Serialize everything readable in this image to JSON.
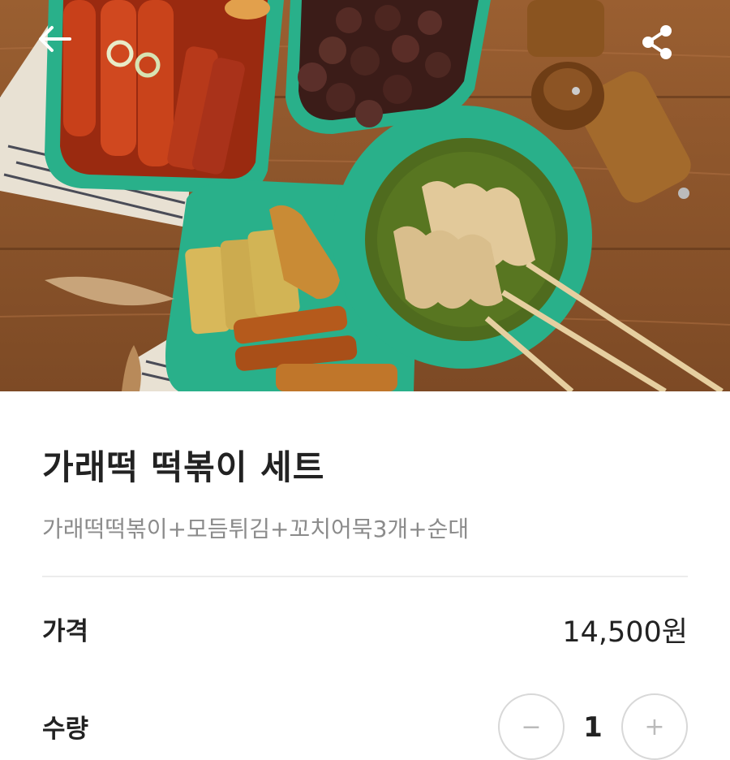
{
  "header": {
    "back_icon": "arrow-left-icon",
    "share_icon": "share-icon"
  },
  "product": {
    "title": "가래떡 떡볶이 세트",
    "description": "가래떡떡볶이+모듬튀김+꼬치어묵3개+순대"
  },
  "price": {
    "label": "가격",
    "value": "14,500원"
  },
  "quantity": {
    "label": "수량",
    "value": "1",
    "minus_label": "−",
    "plus_label": "+"
  }
}
